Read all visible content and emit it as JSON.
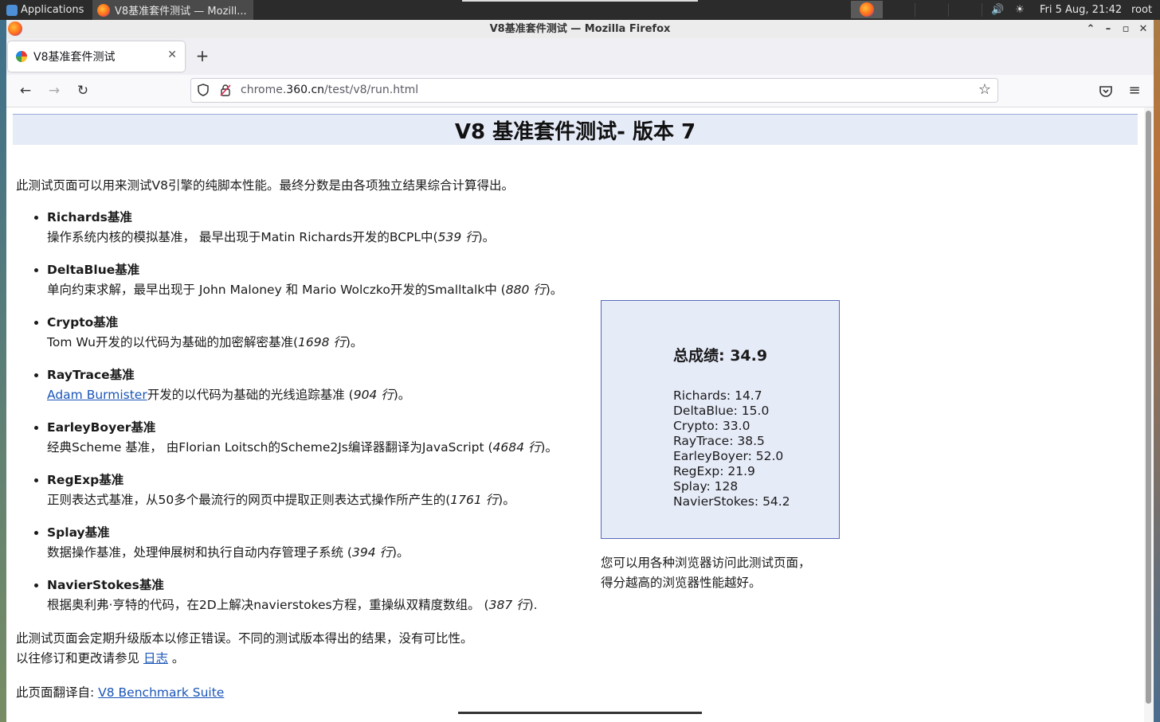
{
  "panel": {
    "applications": "Applications",
    "task_title": "V8基准套件测试 — Mozill...",
    "clock": "Fri  5 Aug, 21:42",
    "user": "root"
  },
  "window": {
    "title": "V8基准套件测试 — Mozilla Firefox"
  },
  "tab": {
    "title": "V8基准套件测试"
  },
  "url": {
    "prefix": "chrome.",
    "domain": "360.cn",
    "path": "/test/v8/run.html"
  },
  "page": {
    "heading": "V8 基准套件测试- 版本 7",
    "intro": "此测试页面可以用来测试V8引擎的纯脚本性能。最终分数是由各项独立结果综合计算得出。",
    "benchmarks": [
      {
        "name": "Richards基准",
        "desc_pre": "操作系统内核的模拟基准， 最早出现于Matin Richards开发的BCPL中(",
        "lines": "539 行",
        "desc_post": ")。"
      },
      {
        "name": "DeltaBlue基准",
        "desc_pre": "单向约束求解，最早出现于 John Maloney 和 Mario Wolczko开发的Smalltalk中 (",
        "lines": "880 行",
        "desc_post": ")。"
      },
      {
        "name": "Crypto基准",
        "desc_pre": "Tom Wu开发的以代码为基础的加密解密基准(",
        "lines": "1698 行",
        "desc_post": ")。"
      },
      {
        "name": "RayTrace基准",
        "link": "Adam Burmister",
        "desc_pre": "开发的以代码为基础的光线追踪基准 (",
        "lines": "904 行",
        "desc_post": ")。"
      },
      {
        "name": "EarleyBoyer基准",
        "desc_pre": "经典Scheme 基准， 由Florian Loitsch的Scheme2Js编译器翻译为JavaScript (",
        "lines": "4684 行",
        "desc_post": ")。"
      },
      {
        "name": "RegExp基准",
        "desc_pre": "正则表达式基准，从50多个最流行的网页中提取正则表达式操作所产生的(",
        "lines": "1761 行",
        "desc_post": ")。"
      },
      {
        "name": "Splay基准",
        "desc_pre": "数据操作基准，处理伸展树和执行自动内存管理子系统 (",
        "lines": "394 行",
        "desc_post": ")。"
      },
      {
        "name": "NavierStokes基准",
        "desc_pre": "根据奥利弗·亨特的代码，在2D上解决navierstokes方程，重操纵双精度数组。 (",
        "lines": "387 行",
        "desc_post": ")."
      }
    ],
    "total_score": "总成绩: 34.9",
    "scores": [
      "Richards: 14.7",
      "DeltaBlue: 15.0",
      "Crypto: 33.0",
      "RayTrace: 38.5",
      "EarleyBoyer: 52.0",
      "RegExp: 21.9",
      "Splay: 128",
      "NavierStokes: 54.2"
    ],
    "note_line1": "您可以用各种浏览器访问此测试页面，",
    "note_line2": "得分越高的浏览器性能越好。",
    "footer_line1": "此测试页面会定期升级版本以修正错误。不同的测试版本得出的结果，没有可比性。",
    "footer_line2_pre": "以往修订和更改请参见 ",
    "footer_log_link": "日志",
    "footer_line2_post": " 。",
    "translated_from_label": "此页面翻译自: ",
    "translated_from_link": "V8 Benchmark Suite"
  }
}
